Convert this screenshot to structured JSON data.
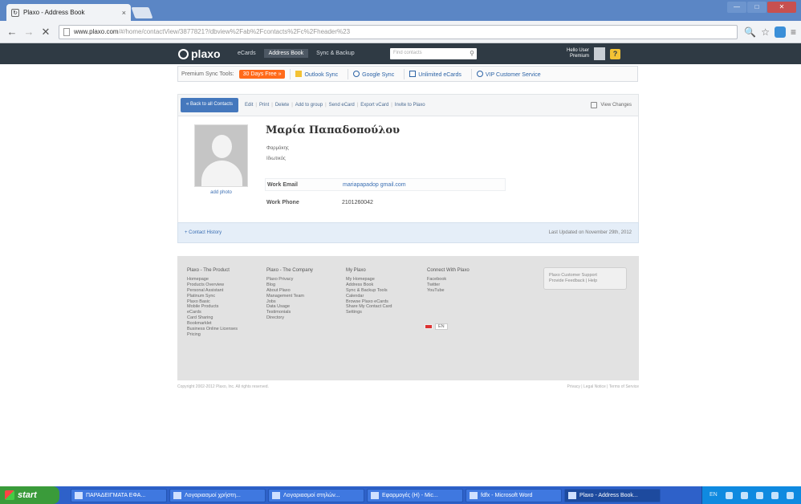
{
  "browser": {
    "tab_title": "Plaxo - Address Book",
    "tab_close": "×",
    "url_host": "www.plaxo.com",
    "url_path": "/#/home/contactView/3877821?/dbview%2Fab%2Fcontacts%2Fc%2Fheader%23",
    "back": "←",
    "forward": "→",
    "stop": "✕",
    "zoom": "🔍",
    "star": "☆",
    "menu": "≡",
    "win_min": "—",
    "win_max": "□",
    "win_close": "✕"
  },
  "plaxo": {
    "logo": "plaxo",
    "nav": [
      "eCards",
      "Address Book",
      "Sync & Backup"
    ],
    "search_placeholder": "Find contacts",
    "user_name": "Hello User",
    "user_sub": "Premium",
    "help": "?"
  },
  "features": {
    "label": "Premium Sync Tools:",
    "free_button": "30 Days Free »",
    "items": [
      "Outlook Sync",
      "Google Sync",
      "Unlimited eCards",
      "VIP Customer Service"
    ]
  },
  "actions_bar": {
    "back_button": "« Back to all Contacts",
    "actions": [
      "Edit",
      "Print",
      "Delete",
      "Add to group",
      "Send eCard",
      "Export vCard",
      "Invite to Plaxo"
    ],
    "view_changes": "View Changes"
  },
  "contact": {
    "name": "Μαρία Παπαδοπούλου",
    "line1": "Φαρμάκης",
    "line2": "Ιδιωτικός",
    "add_photo": "add photo",
    "fields": [
      {
        "label": "Work Email",
        "value": "mariapapadop gmail.com"
      },
      {
        "label": "Work Phone",
        "value": "2101260042"
      }
    ]
  },
  "history": {
    "link": "+ Contact History",
    "updated": "Last Updated on November 29th, 2012"
  },
  "footer": {
    "columns": [
      {
        "heading": "Plaxo - The Product",
        "items": [
          "Homepage",
          "Products Overview",
          "Personal Assistant",
          "Platinum Sync",
          "Plaxo Basic",
          "Mobile Products",
          "eCards",
          "Card Sharing",
          "Bookmarklet",
          "Business Online Licenses",
          "Pricing"
        ]
      },
      {
        "heading": "Plaxo - The Company",
        "items": [
          "Plaxo Privacy",
          "Blog",
          "About Plaxo",
          "Management Team",
          "Jobs",
          "Data Usage",
          "Testimonials",
          "Directory"
        ]
      },
      {
        "heading": "My Plaxo",
        "items": [
          "My Homepage",
          "Address Book",
          "Sync & Backup Tools",
          "Calendar",
          "Browse Plaxo eCards",
          "Share My Contact Card",
          "Settings"
        ]
      },
      {
        "heading": "Connect With Plaxo",
        "items": [
          "Facebook",
          "Twitter",
          "YouTube"
        ]
      }
    ],
    "support_line1": "Plaxo Customer Support",
    "support_line2": "Provide Feedback | Help",
    "language": "EN",
    "copyright": "Copyright 2002-2012 Plaxo, Inc. All rights reserved.",
    "legal": "Privacy | Legal Notice | Terms of Service"
  },
  "taskbar": {
    "start": "start",
    "tasks": [
      "ΠΑΡΑΔΕΙΓΜΑΤΑ ΕΦΑ...",
      "Λογαριασμοί χρήστη...",
      "Λογαριασμοί στηλών...",
      "Εφαρμογές (H) - Mic...",
      "fdfx - Microsoft Word",
      "Plaxo - Address Book..."
    ],
    "lang": "EN"
  },
  "colors": {
    "plaxo_bar": "#2f3a44",
    "accent": "#4578bd",
    "free_button": "#ff6a1a",
    "taskbar": "#2e61c9",
    "start_button": "#3a9b3a"
  }
}
